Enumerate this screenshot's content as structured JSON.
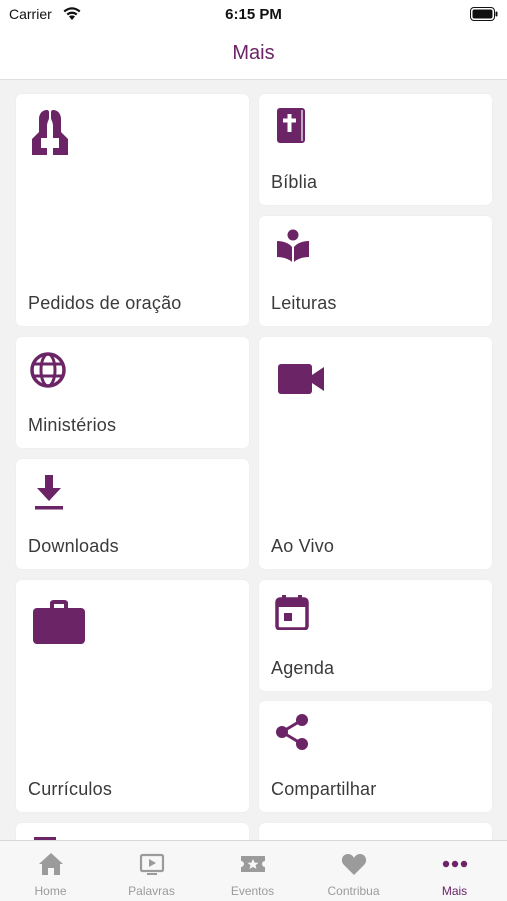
{
  "status_bar": {
    "carrier": "Carrier",
    "time": "6:15 PM"
  },
  "nav": {
    "title": "Mais"
  },
  "colors": {
    "accent": "#6b2466",
    "tab_inactive": "#9b9b9b",
    "background": "#f2f2f2",
    "card": "#ffffff"
  },
  "menu": {
    "items": [
      {
        "label": "Pedidos de oração",
        "icon": "praying-hands-icon"
      },
      {
        "label": "Bíblia",
        "icon": "bible-icon"
      },
      {
        "label": "Leituras",
        "icon": "reading-icon"
      },
      {
        "label": "Ministérios",
        "icon": "globe-icon"
      },
      {
        "label": "Ao Vivo",
        "icon": "video-camera-icon"
      },
      {
        "label": "Downloads",
        "icon": "download-icon"
      },
      {
        "label": "Currículos",
        "icon": "briefcase-icon"
      },
      {
        "label": "Agenda",
        "icon": "calendar-icon"
      },
      {
        "label": "Compartilhar",
        "icon": "share-icon"
      }
    ]
  },
  "tabs": [
    {
      "label": "Home",
      "icon": "home-icon"
    },
    {
      "label": "Palavras",
      "icon": "play-screen-icon"
    },
    {
      "label": "Eventos",
      "icon": "ticket-icon"
    },
    {
      "label": "Contribua",
      "icon": "heart-icon"
    },
    {
      "label": "Mais",
      "icon": "more-dots-icon",
      "active": true
    }
  ]
}
